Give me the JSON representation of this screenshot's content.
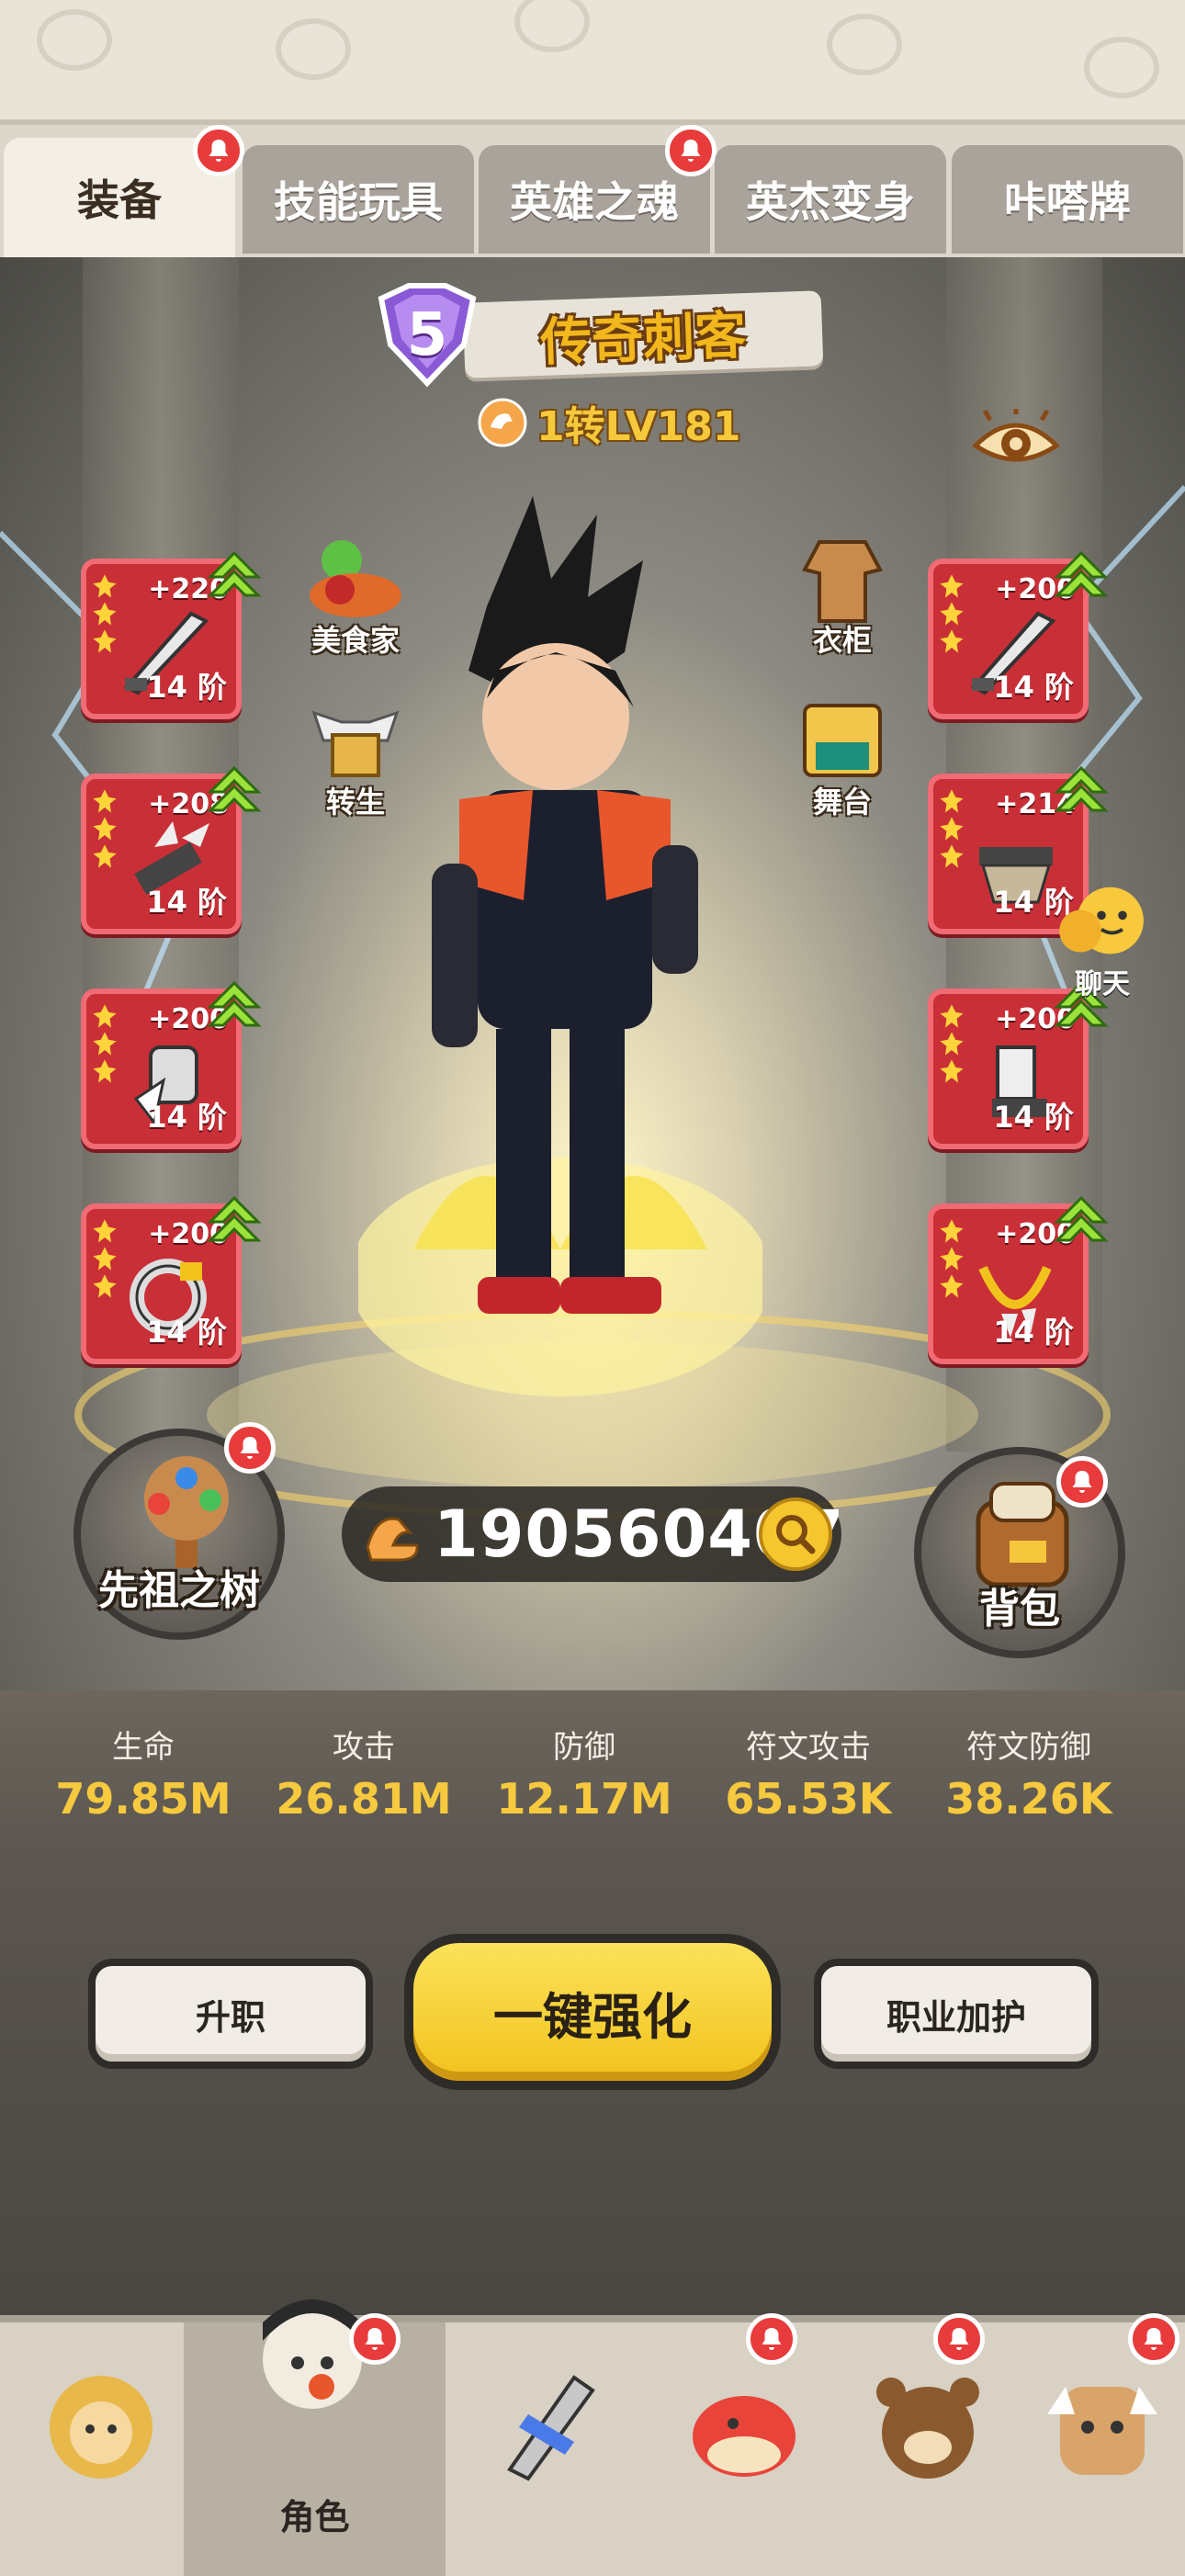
{
  "tabs": [
    {
      "label": "装备",
      "active": true,
      "badge": true
    },
    {
      "label": "技能玩具",
      "active": false,
      "badge": false
    },
    {
      "label": "英雄之魂",
      "active": false,
      "badge": true
    },
    {
      "label": "英杰变身",
      "active": false,
      "badge": false
    },
    {
      "label": "咔嗒牌",
      "active": false,
      "badge": false
    }
  ],
  "hero": {
    "rank": "5",
    "title": "传奇刺客",
    "level": "1转LV181"
  },
  "equipment_left": [
    {
      "bonus": "+220",
      "tier": "14 阶",
      "icon": "dagger-icon"
    },
    {
      "bonus": "+208",
      "tier": "14 阶",
      "icon": "claw-icon"
    },
    {
      "bonus": "+200",
      "tier": "14 阶",
      "icon": "gauntlet-icon"
    },
    {
      "bonus": "+200",
      "tier": "14 阶",
      "icon": "ring-icon"
    }
  ],
  "equipment_right": [
    {
      "bonus": "+200",
      "tier": "14 阶",
      "icon": "dagger-icon"
    },
    {
      "bonus": "+214",
      "tier": "14 阶",
      "icon": "armor-icon"
    },
    {
      "bonus": "+200",
      "tier": "14 阶",
      "icon": "boots-icon"
    },
    {
      "bonus": "+200",
      "tier": "14 阶",
      "icon": "necklace-icon"
    }
  ],
  "side_menu": {
    "gourmet": "美食家",
    "rebirth": "转生",
    "wardrobe": "衣柜",
    "stage": "舞台",
    "chat": "聊天"
  },
  "actions": {
    "ancestor_tree": "先祖之树",
    "bag": "背包",
    "power": "190560407"
  },
  "stats": [
    {
      "label": "生命",
      "value": "79.85M"
    },
    {
      "label": "攻击",
      "value": "26.81M"
    },
    {
      "label": "防御",
      "value": "12.17M"
    },
    {
      "label": "符文攻击",
      "value": "65.53K"
    },
    {
      "label": "符文防御",
      "value": "38.26K"
    }
  ],
  "buttons": {
    "promote": "升职",
    "one_click": "一键强化",
    "job_protect": "职业加护"
  },
  "bottom_nav": [
    {
      "label": "",
      "icon": "lion-icon",
      "badge": false
    },
    {
      "label": "角色",
      "icon": "ninja-avatar-icon",
      "badge": true,
      "active": true
    },
    {
      "label": "",
      "icon": "weapon-icon",
      "badge": false
    },
    {
      "label": "",
      "icon": "dragon-icon",
      "badge": true
    },
    {
      "label": "",
      "icon": "bear-icon",
      "badge": true
    },
    {
      "label": "",
      "icon": "ogre-icon",
      "badge": true
    }
  ],
  "colors": {
    "slot_red": "#c92f37",
    "gold": "#f6c93e",
    "badge_red": "#e83b3b"
  }
}
